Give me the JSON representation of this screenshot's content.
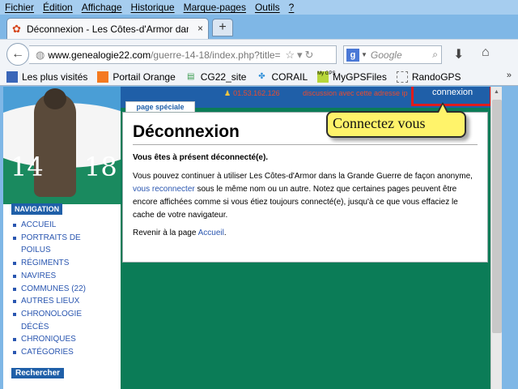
{
  "menu": [
    "Fichier",
    "Édition",
    "Affichage",
    "Historique",
    "Marque-pages",
    "Outils",
    "?"
  ],
  "tab": {
    "title": "Déconnexion - Les Côtes-d'Armor dans l...",
    "close": "×",
    "new_tab": "+"
  },
  "nav": {
    "url_domain": "www.genealogie22.com",
    "url_path": "/guerre-14-18/index.php?title=",
    "search_engine": "g",
    "search_placeholder": "Google"
  },
  "bookmarks": [
    "Les plus visités",
    "Portail Orange",
    "CG22_site",
    "CORAIL",
    "MyGPSFiles",
    "RandoGPS"
  ],
  "page": {
    "phone": "01.53.162.126",
    "discussion": "discussion avec cette adresse ip",
    "connexion": "connexion",
    "logo_left": "14",
    "logo_right": "18",
    "nav_title": "NAVIGATION",
    "nav_items": [
      "ACCUEIL",
      "PORTRAITS DE",
      "POILUS",
      "RÉGIMENTS",
      "NAVIRES",
      "COMMUNES (22)",
      "AUTRES LIEUX",
      "CHRONOLOGIE",
      "DÉCÈS",
      "CHRONIQUES",
      "CATÉGORIES"
    ],
    "search_title": "Rechercher",
    "page_tab": "page spéciale",
    "heading": "Déconnexion",
    "logged_out": "Vous êtes à présent déconnecté(e).",
    "para_before_link": "Vous pouvez continuer à utiliser Les Côtes-d'Armor dans la Grande Guerre de façon anonyme, ",
    "para_link": "vous reconnecter",
    "para_after_link": " sous le même nom ou un autre. Notez que certaines pages peuvent être encore affichées comme si vous étiez toujours connecté(e), jusqu'à ce que vous effaciez le cache de votre navigateur.",
    "return_text": "Revenir à la page ",
    "return_link": "Accueil",
    "return_end": "."
  },
  "callout": "Connectez vous",
  "colors": {
    "menubar": "#a6cdef",
    "site_green": "#0b7c57",
    "site_blue": "#1f5fa8",
    "highlight": "#e11b1b",
    "callout": "#fff36a"
  }
}
